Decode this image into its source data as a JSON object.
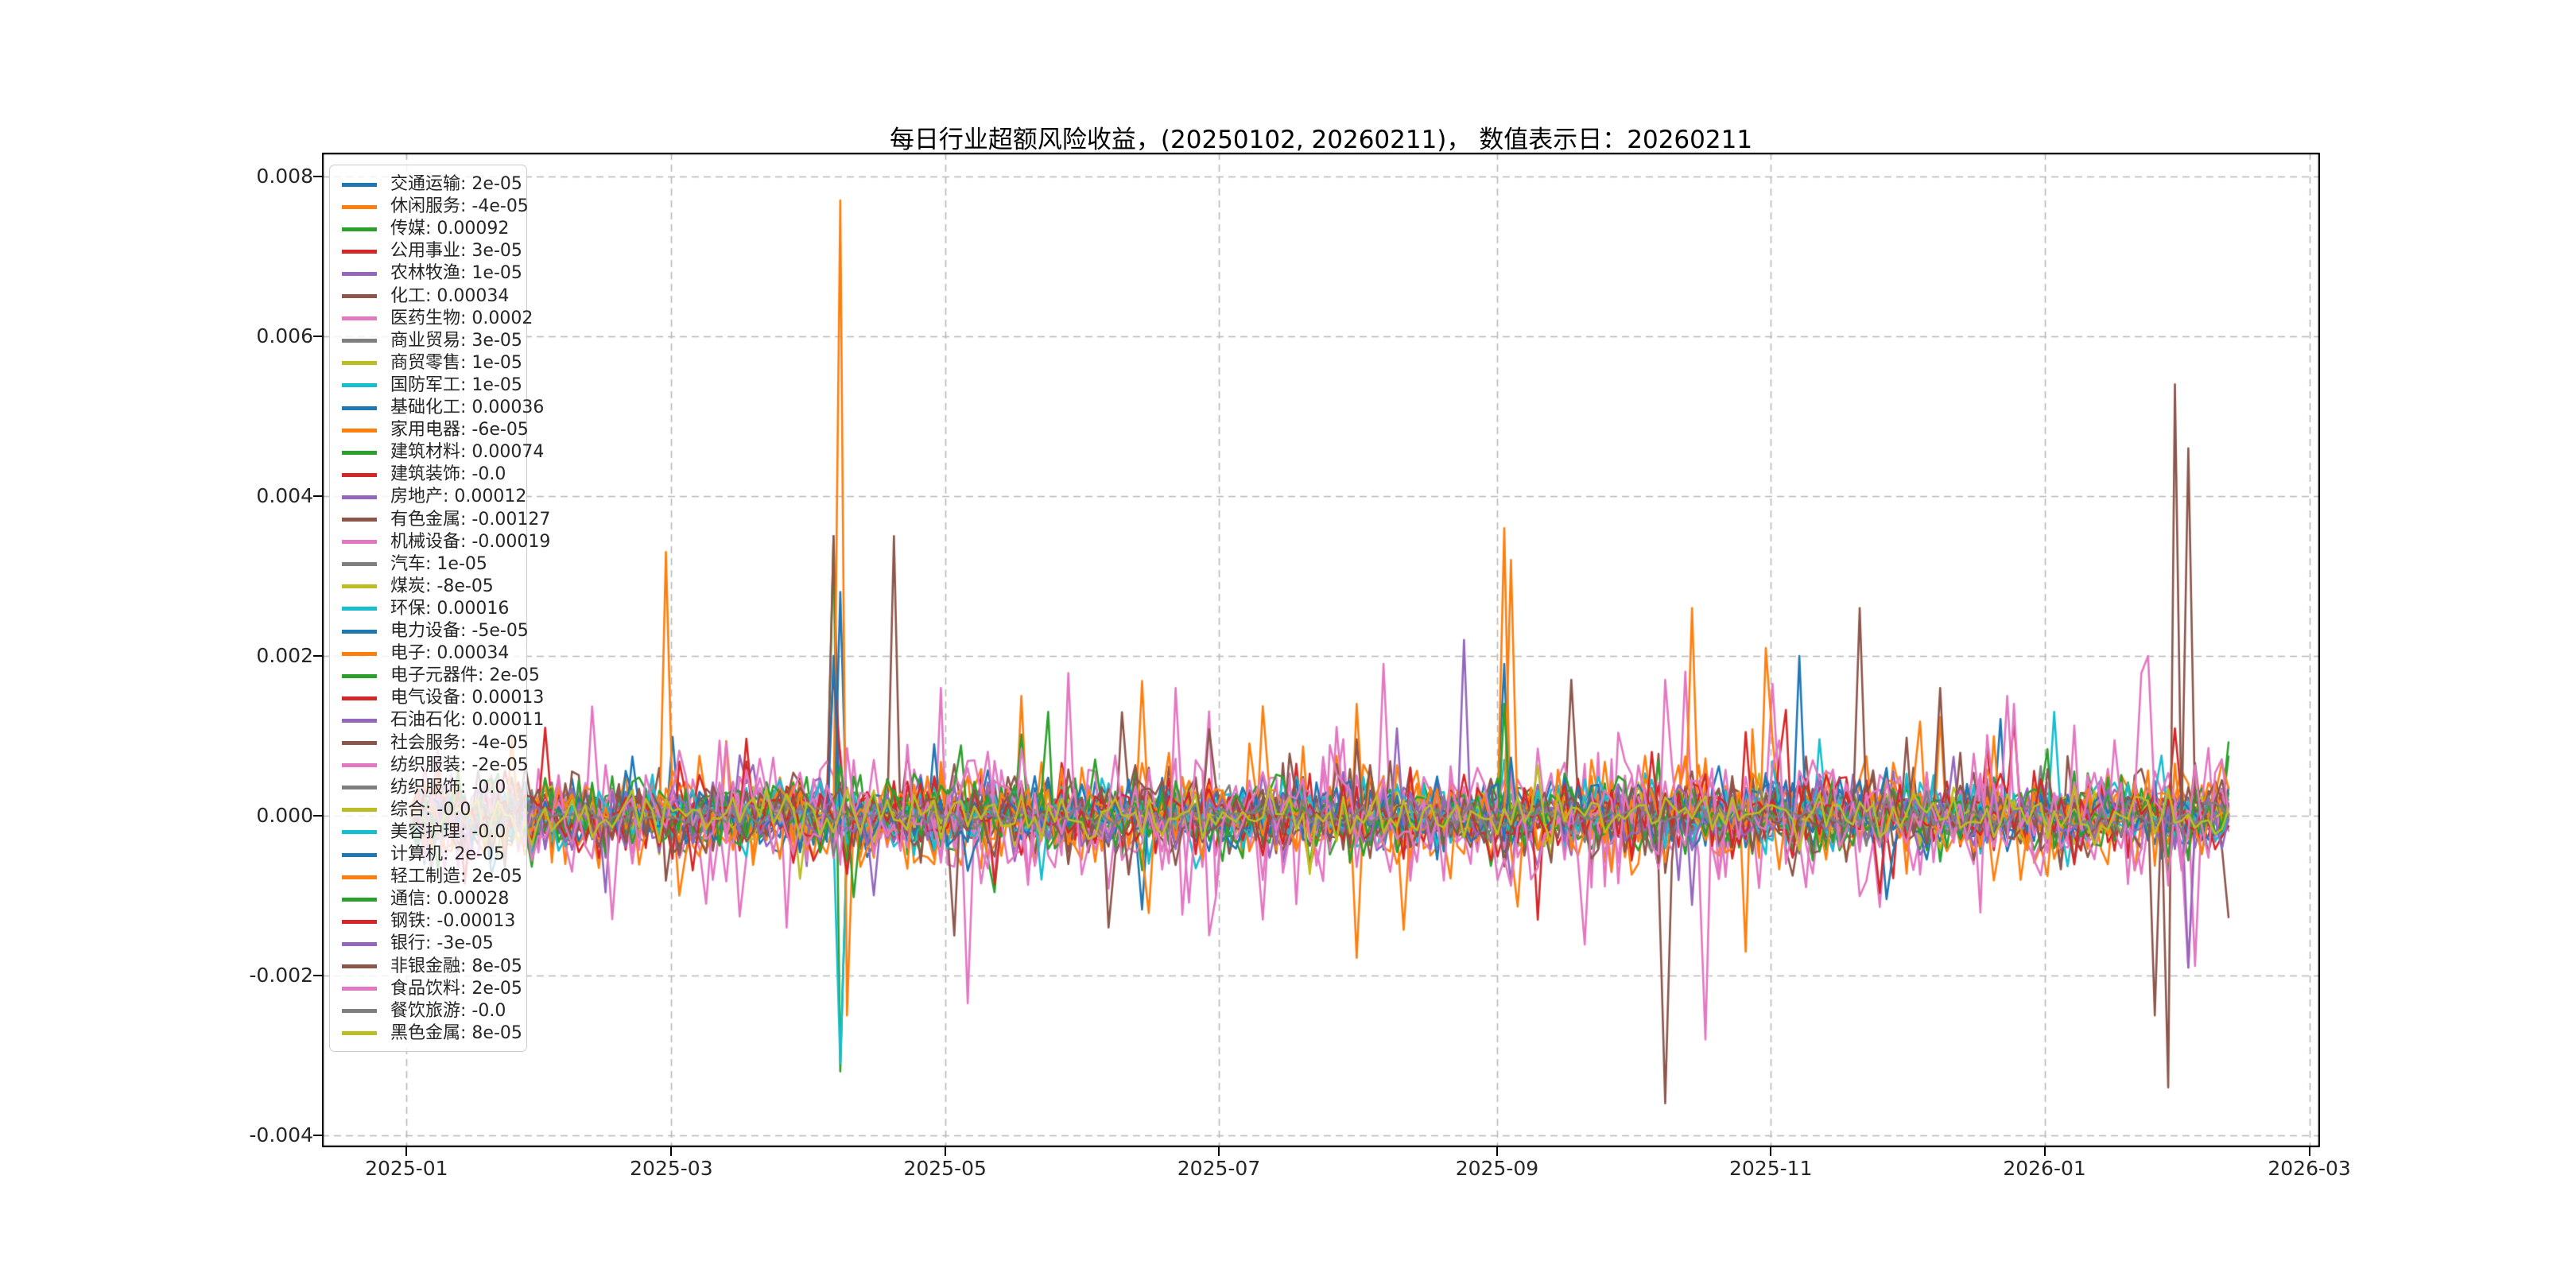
{
  "title": "每日行业超额风险收益，(20250102, 20260211)， 数值表示日：20260211",
  "chart_data": {
    "type": "line",
    "title": "每日行业超额风险收益，(20250102, 20260211)， 数值表示日：20260211",
    "x_start": "2025-01-02",
    "x_end": "2026-02-11",
    "x_span_days": 405,
    "n_points": 272,
    "ylim": [
      -0.00415,
      0.0083
    ],
    "grid": true,
    "grid_style": "dashed",
    "grid_color": "#b8b8b8",
    "legend_position": "upper left",
    "y_ticks": [
      {
        "value": 0.008,
        "label": "0.008"
      },
      {
        "value": 0.006,
        "label": "0.006"
      },
      {
        "value": 0.004,
        "label": "0.004"
      },
      {
        "value": 0.002,
        "label": "0.002"
      },
      {
        "value": 0.0,
        "label": "0.000"
      },
      {
        "value": -0.002,
        "label": "-0.002"
      },
      {
        "value": -0.004,
        "label": "-0.004"
      }
    ],
    "x_ticks": [
      {
        "day": -1,
        "label": "2025-01"
      },
      {
        "day": 58,
        "label": "2025-03"
      },
      {
        "day": 119,
        "label": "2025-05"
      },
      {
        "day": 180,
        "label": "2025-07"
      },
      {
        "day": 242,
        "label": "2025-09"
      },
      {
        "day": 303,
        "label": "2025-11"
      },
      {
        "day": 364,
        "label": "2026-01"
      },
      {
        "day": 423,
        "label": "2026-03"
      }
    ],
    "series": [
      {
        "name": "交通运输",
        "value": 2e-05,
        "value_label": "2e-05",
        "label": "交通运输: 2e-05",
        "color": "#1f77b4",
        "sigma": 0.00018
      },
      {
        "name": "休闲服务",
        "value": -4e-05,
        "value_label": "-4e-05",
        "label": "休闲服务: -4e-05",
        "color": "#ff7f0e",
        "sigma": 0.00028
      },
      {
        "name": "传媒",
        "value": 0.00092,
        "value_label": "0.00092",
        "label": "传媒: 0.00092",
        "color": "#2ca02c",
        "sigma": 0.00025
      },
      {
        "name": "公用事业",
        "value": 3e-05,
        "value_label": "3e-05",
        "label": "公用事业: 3e-05",
        "color": "#d62728",
        "sigma": 0.0002
      },
      {
        "name": "农林牧渔",
        "value": 1e-05,
        "value_label": "1e-05",
        "label": "农林牧渔: 1e-05",
        "color": "#9467bd",
        "sigma": 0.0002
      },
      {
        "name": "化工",
        "value": 0.00034,
        "value_label": "0.00034",
        "label": "化工: 0.00034",
        "color": "#8c564b",
        "sigma": 0.00024
      },
      {
        "name": "医药生物",
        "value": 0.0002,
        "value_label": "0.0002",
        "label": "医药生物: 0.0002",
        "color": "#e377c2",
        "sigma": 0.00038
      },
      {
        "name": "商业贸易",
        "value": 3e-05,
        "value_label": "3e-05",
        "label": "商业贸易: 3e-05",
        "color": "#7f7f7f",
        "sigma": 0.00012
      },
      {
        "name": "商贸零售",
        "value": 1e-05,
        "value_label": "1e-05",
        "label": "商贸零售: 1e-05",
        "color": "#bcbd22",
        "sigma": 0.00014
      },
      {
        "name": "国防军工",
        "value": 1e-05,
        "value_label": "1e-05",
        "label": "国防军工: 1e-05",
        "color": "#17becf",
        "sigma": 0.00022
      },
      {
        "name": "基础化工",
        "value": 0.00036,
        "value_label": "0.00036",
        "label": "基础化工: 0.00036",
        "color": "#1f77b4",
        "sigma": 0.0002
      },
      {
        "name": "家用电器",
        "value": -6e-05,
        "value_label": "-6e-05",
        "label": "家用电器: -6e-05",
        "color": "#ff7f0e",
        "sigma": 0.00028
      },
      {
        "name": "建筑材料",
        "value": 0.00074,
        "value_label": "0.00074",
        "label": "建筑材料: 0.00074",
        "color": "#2ca02c",
        "sigma": 0.00022
      },
      {
        "name": "建筑装饰",
        "value": -4e-06,
        "value_label": "-0.0",
        "label": "建筑装饰: -0.0",
        "color": "#d62728",
        "sigma": 0.00018
      },
      {
        "name": "房地产",
        "value": 0.00012,
        "value_label": "0.00012",
        "label": "房地产: 0.00012",
        "color": "#9467bd",
        "sigma": 0.00022
      },
      {
        "name": "有色金属",
        "value": -0.00127,
        "value_label": "-0.00127",
        "label": "有色金属: -0.00127",
        "color": "#8c564b",
        "sigma": 0.00028
      },
      {
        "name": "机械设备",
        "value": -0.00019,
        "value_label": "-0.00019",
        "label": "机械设备: -0.00019",
        "color": "#e377c2",
        "sigma": 0.00036
      },
      {
        "name": "汽车",
        "value": 1e-05,
        "value_label": "1e-05",
        "label": "汽车: 1e-05",
        "color": "#7f7f7f",
        "sigma": 0.00012
      },
      {
        "name": "煤炭",
        "value": -8e-05,
        "value_label": "-8e-05",
        "label": "煤炭: -8e-05",
        "color": "#bcbd22",
        "sigma": 0.00016
      },
      {
        "name": "环保",
        "value": 0.00016,
        "value_label": "0.00016",
        "label": "环保: 0.00016",
        "color": "#17becf",
        "sigma": 0.0002
      },
      {
        "name": "电力设备",
        "value": -5e-05,
        "value_label": "-5e-05",
        "label": "电力设备: -5e-05",
        "color": "#1f77b4",
        "sigma": 0.0002
      },
      {
        "name": "电子",
        "value": 0.00034,
        "value_label": "0.00034",
        "label": "电子: 0.00034",
        "color": "#ff7f0e",
        "sigma": 0.0003
      },
      {
        "name": "电子元器件",
        "value": 2e-05,
        "value_label": "2e-05",
        "label": "电子元器件: 2e-05",
        "color": "#2ca02c",
        "sigma": 0.00022
      },
      {
        "name": "电气设备",
        "value": 0.00013,
        "value_label": "0.00013",
        "label": "电气设备: 0.00013",
        "color": "#d62728",
        "sigma": 0.00022
      },
      {
        "name": "石油石化",
        "value": 0.00011,
        "value_label": "0.00011",
        "label": "石油石化: 0.00011",
        "color": "#9467bd",
        "sigma": 0.00018
      },
      {
        "name": "社会服务",
        "value": -4e-05,
        "value_label": "-4e-05",
        "label": "社会服务: -4e-05",
        "color": "#8c564b",
        "sigma": 0.00022
      },
      {
        "name": "纺织服装",
        "value": -2e-05,
        "value_label": "-2e-05",
        "label": "纺织服装: -2e-05",
        "color": "#e377c2",
        "sigma": 0.0003
      },
      {
        "name": "纺织服饰",
        "value": -4e-06,
        "value_label": "-0.0",
        "label": "纺织服饰: -0.0",
        "color": "#7f7f7f",
        "sigma": 0.0001
      },
      {
        "name": "综合",
        "value": -4e-06,
        "value_label": "-0.0",
        "label": "综合: -0.0",
        "color": "#bcbd22",
        "sigma": 6e-05
      },
      {
        "name": "美容护理",
        "value": -4e-06,
        "value_label": "-0.0",
        "label": "美容护理: -0.0",
        "color": "#17becf",
        "sigma": 0.00016
      },
      {
        "name": "计算机",
        "value": 2e-05,
        "value_label": "2e-05",
        "label": "计算机: 2e-05",
        "color": "#1f77b4",
        "sigma": 0.00022
      },
      {
        "name": "轻工制造",
        "value": 2e-05,
        "value_label": "2e-05",
        "label": "轻工制造: 2e-05",
        "color": "#ff7f0e",
        "sigma": 0.00026
      },
      {
        "name": "通信",
        "value": 0.00028,
        "value_label": "0.00028",
        "label": "通信: 0.00028",
        "color": "#2ca02c",
        "sigma": 0.00024
      },
      {
        "name": "钢铁",
        "value": -0.00013,
        "value_label": "-0.00013",
        "label": "钢铁: -0.00013",
        "color": "#d62728",
        "sigma": 0.0002
      },
      {
        "name": "银行",
        "value": -3e-05,
        "value_label": "-3e-05",
        "label": "银行: -3e-05",
        "color": "#9467bd",
        "sigma": 0.00018
      },
      {
        "name": "非银金融",
        "value": 8e-05,
        "value_label": "8e-05",
        "label": "非银金融: 8e-05",
        "color": "#8c564b",
        "sigma": 0.00024
      },
      {
        "name": "食品饮料",
        "value": 2e-05,
        "value_label": "2e-05",
        "label": "食品饮料: 2e-05",
        "color": "#e377c2",
        "sigma": 0.00036
      },
      {
        "name": "餐饮旅游",
        "value": -4e-06,
        "value_label": "-0.0",
        "label": "餐饮旅游: -0.0",
        "color": "#7f7f7f",
        "sigma": 8e-05
      },
      {
        "name": "黑色金属",
        "value": 8e-05,
        "value_label": "8e-05",
        "label": "黑色金属: 8e-05",
        "color": "#bcbd22",
        "sigma": 0.00016
      }
    ],
    "spikes": [
      [
        21,
        0.2345,
        0.0077
      ],
      [
        21,
        0.2389,
        -0.0025
      ],
      [
        21,
        0.6,
        0.0036
      ],
      [
        21,
        0.7454,
        0.0021
      ],
      [
        2,
        0.231,
        0.0035
      ],
      [
        2,
        0.237,
        -0.0032
      ],
      [
        5,
        0.2335,
        0.0035
      ],
      [
        5,
        0.266,
        0.0035
      ],
      [
        10,
        0.2345,
        0.0028
      ],
      [
        9,
        0.2355,
        -0.0031
      ],
      [
        30,
        0.234,
        0.002
      ],
      [
        30,
        0.7655,
        0.002
      ],
      [
        23,
        0.2325,
        0.0018
      ],
      [
        23,
        0.62,
        -0.0013
      ],
      [
        11,
        0.1417,
        0.0033
      ],
      [
        11,
        0.146,
        -0.001
      ],
      [
        11,
        0.52,
        0.0014
      ],
      [
        11,
        0.703,
        0.0026
      ],
      [
        16,
        0.207,
        -0.0014
      ],
      [
        16,
        0.47,
        -0.0013
      ],
      [
        16,
        0.7108,
        -0.0028
      ],
      [
        16,
        0.878,
        0.0015
      ],
      [
        16,
        0.978,
        -0.0019
      ],
      [
        15,
        0.3,
        -0.0015
      ],
      [
        15,
        0.639,
        0.0017
      ],
      [
        15,
        0.6916,
        -0.0036
      ],
      [
        6,
        0.29,
        0.0016
      ],
      [
        6,
        0.535,
        0.0019
      ],
      [
        1,
        0.336,
        0.0015
      ],
      [
        1,
        0.734,
        -0.0017
      ],
      [
        22,
        0.35,
        0.0013
      ],
      [
        25,
        0.385,
        -0.0014
      ],
      [
        36,
        0.42,
        0.0016
      ],
      [
        36,
        0.691,
        0.0017
      ],
      [
        36,
        0.881,
        0.0014
      ],
      [
        36,
        0.955,
        0.002
      ],
      [
        34,
        0.58,
        0.0022
      ],
      [
        34,
        0.978,
        -0.0019
      ],
      [
        31,
        0.605,
        0.0032
      ],
      [
        20,
        0.6005,
        0.0019
      ],
      [
        32,
        0.601,
        0.0014
      ],
      [
        35,
        0.7975,
        0.0026
      ],
      [
        35,
        0.8417,
        0.0016
      ],
      [
        35,
        0.9593,
        -0.0025
      ],
      [
        35,
        0.965,
        -0.0034
      ],
      [
        35,
        0.9694,
        0.0054
      ],
      [
        35,
        0.9777,
        0.0046
      ],
      [
        29,
        0.905,
        0.0013
      ]
    ],
    "noise": {
      "tail_prob": 0.05,
      "tail_mult": 2.4
    }
  }
}
